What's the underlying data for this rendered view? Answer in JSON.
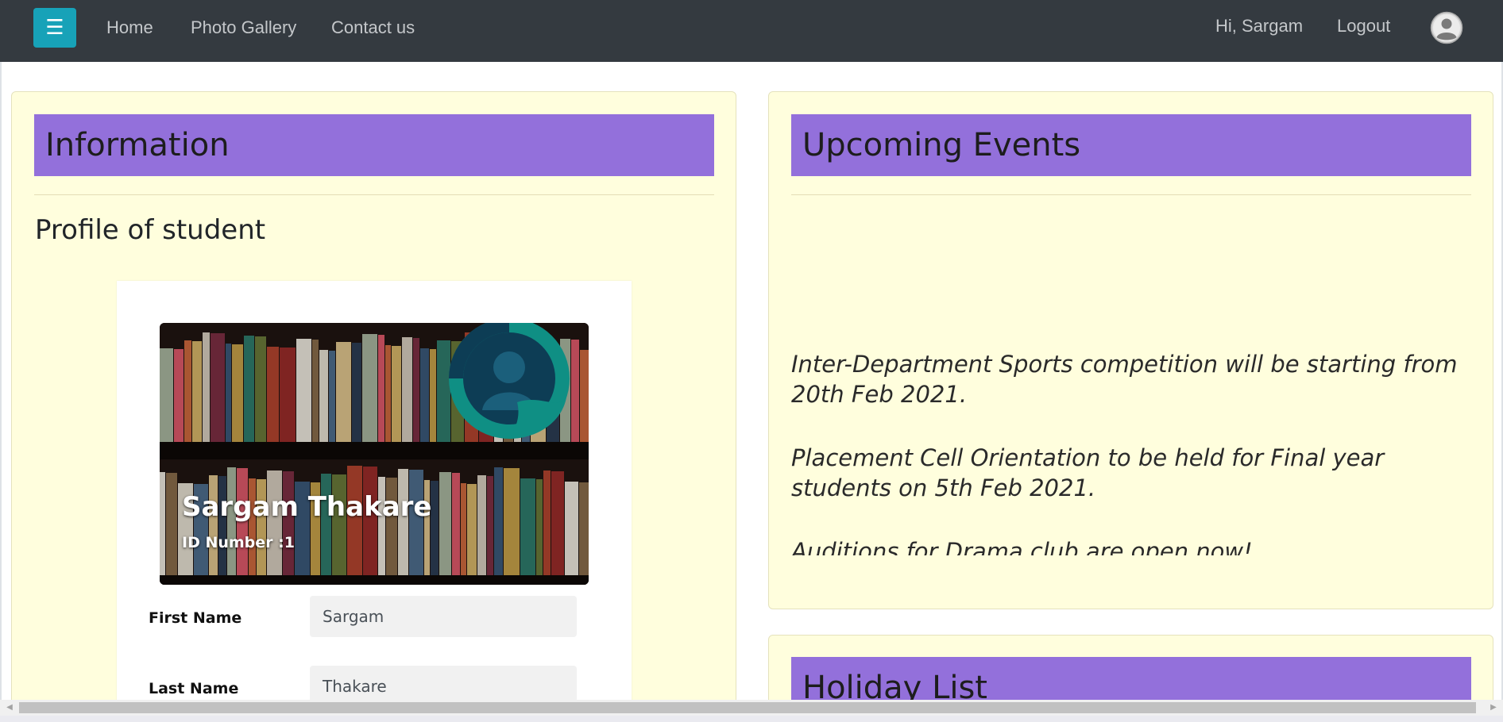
{
  "navbar": {
    "toggle_glyph": "☰",
    "links": [
      "Home",
      "Photo Gallery",
      "Contact us"
    ],
    "greeting": "Hi, Sargam",
    "logout": "Logout",
    "avatar_icon": "user-circle-icon"
  },
  "information": {
    "heading": "Information",
    "profile_title": "Profile of student",
    "student_name": "Sargam Thakare",
    "id_label": "ID Number :1",
    "fields": [
      {
        "label": "First Name",
        "value": "Sargam"
      },
      {
        "label": "Last Name",
        "value": "Thakare"
      }
    ]
  },
  "events": {
    "heading": "Upcoming Events",
    "items": [
      "Inter-Department Sports competition will be starting from 20th Feb 2021.",
      "Placement Cell Orientation to be held for Final year students on 5th Feb 2021.",
      "Auditions for Drama club are open now!"
    ]
  },
  "holidays": {
    "heading": "Holiday List"
  },
  "colors": {
    "navbar": "#343a40",
    "toggle": "#17a2b8",
    "panel_bg": "#fffedd",
    "panel_heading": "#9370db"
  }
}
